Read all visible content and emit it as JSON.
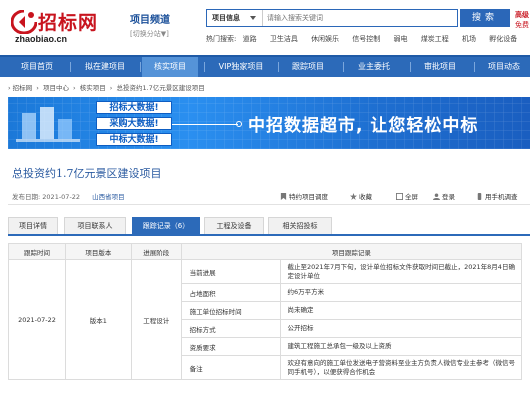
{
  "header": {
    "logo_text": "招标网",
    "logo_domain": "zhaobiao.cn",
    "channel_title": "项目频道",
    "channel_switch": "[切换分站▼]",
    "search_type": "项目信息",
    "search_placeholder": "请输入搜索关键词",
    "search_button": "搜索",
    "register_1": "高级",
    "register_2": "免费",
    "hot_label": "热门搜索:",
    "hot_items": [
      "道路",
      "卫生洁具",
      "休闲娱乐",
      "信号控制",
      "弱电",
      "煤炭工程",
      "机场",
      "孵化设备"
    ]
  },
  "nav": [
    "项目首页",
    "拟在建项目",
    "核实项目",
    "VIP独家项目",
    "跟踪项目",
    "业主委托",
    "审批项目",
    "项目动态"
  ],
  "nav_active_index": 2,
  "breadcrumb": [
    "› 招标网",
    "›",
    "项目中心",
    "›",
    "核实项目",
    "›",
    "总投资约1.7亿元景区建设项目"
  ],
  "banner": {
    "tags": [
      "招标大数据!",
      "采购大数据!",
      "中标大数据!"
    ],
    "headline": "中招数据超市, 让您轻松中标"
  },
  "project": {
    "title": "总投资约1.7亿元景区建设项目",
    "publish_label": "发布日期:",
    "publish_date": "2021-07-22",
    "province": "山西省项目",
    "actions": [
      "特约项目调度",
      "收藏",
      "全屏",
      "登录",
      "用手机调查"
    ]
  },
  "tabs": [
    "项目详情",
    "项目联系人",
    "跟踪记录（6）",
    "工程及设备",
    "相关招投标"
  ],
  "tabs_active_index": 2,
  "table": {
    "headers": [
      "跟踪时间",
      "项目版本",
      "进展阶段",
      "项目跟踪记录"
    ],
    "date": "2021-07-22",
    "version": "版本1",
    "stage": "工程设计",
    "rows": [
      {
        "label": "当前进展",
        "value": "截止至2021年7月下旬，设计单位招标文件获取时间已截止，2021年8月4日确定设计单位"
      },
      {
        "label": "占地面积",
        "value": "约6万平方米"
      },
      {
        "label": "施工单位招标时间",
        "value": "尚未确定"
      },
      {
        "label": "招标方式",
        "value": "公开招标"
      },
      {
        "label": "资质要求",
        "value": "建筑工程施工总承包一级及以上资质"
      },
      {
        "label": "备注",
        "value": "欢迎有意向的施工单位发送电子营资料至业主方负责人微信专业主参考（微信号同手机号），以便获得合作机会"
      }
    ]
  },
  "colors": {
    "brand_red": "#c8141e",
    "nav_blue": "#2c6ab9",
    "nav_active": "#5593d8",
    "link_blue": "#2a5aa0"
  }
}
